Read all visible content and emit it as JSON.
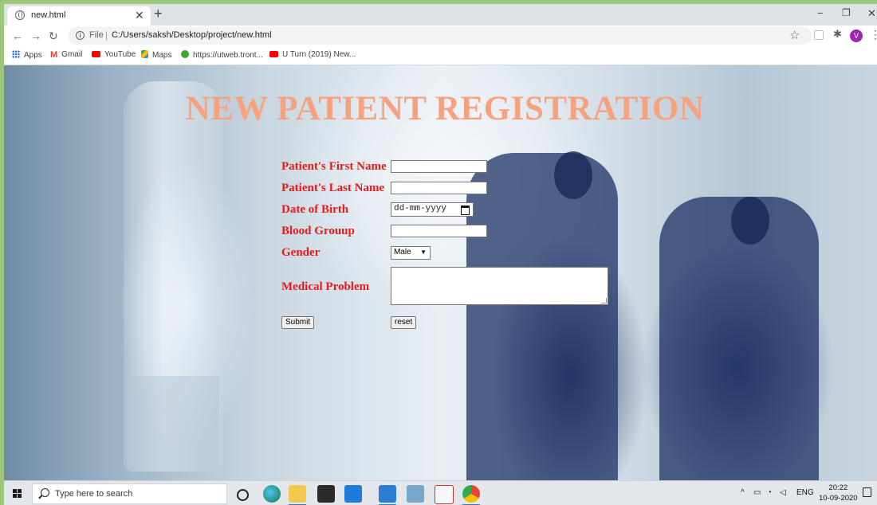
{
  "browser": {
    "tab_title": "new.html",
    "url_scheme": "File",
    "url_path": "C:/Users/saksh/Desktop/project/new.html",
    "profile_initial": "V",
    "bookmarks": [
      {
        "label": "Apps",
        "icon": "apps-grid-icon"
      },
      {
        "label": "Gmail",
        "icon": "gmail-icon"
      },
      {
        "label": "YouTube",
        "icon": "youtube-icon"
      },
      {
        "label": "Maps",
        "icon": "maps-icon"
      },
      {
        "label": "https://utweb.tront...",
        "icon": "utorrent-icon"
      },
      {
        "label": "U Turn (2019) New...",
        "icon": "youtube-icon"
      }
    ]
  },
  "page": {
    "title": "NEW PATIENT REGISTRATION",
    "form": {
      "first_name_label": "Patient's First Name",
      "last_name_label": "Patient's Last Name",
      "dob_label": "Date of Birth",
      "dob_placeholder": "dd-mm-yyyy",
      "blood_group_label": "Blood Grouup",
      "gender_label": "Gender",
      "gender_selected": "Male",
      "medical_problem_label": "Medical Problem",
      "submit_label": "Submit",
      "reset_label": "reset"
    },
    "colors": {
      "title": "#f7a27e",
      "label": "#e81a1a"
    }
  },
  "taskbar": {
    "search_placeholder": "Type here to search",
    "language": "ENG",
    "time": "20:22",
    "date": "10-09-2020"
  }
}
